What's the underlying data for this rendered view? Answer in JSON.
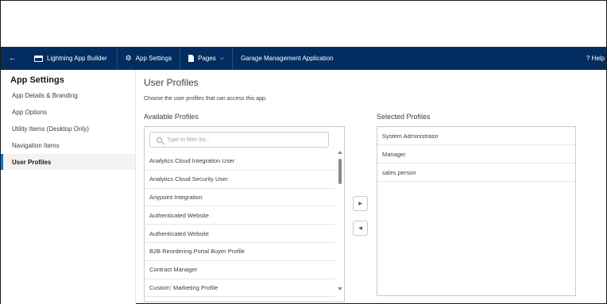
{
  "navbar": {
    "app_builder": "Lightning App Builder",
    "app_settings": "App Settings",
    "pages": "Pages",
    "app_name": "Garage Management Application",
    "help": "? Help"
  },
  "sidebar": {
    "title": "App Settings",
    "items": [
      {
        "label": "App Details & Branding"
      },
      {
        "label": "App Options"
      },
      {
        "label": "Utility Items (Desktop Only)"
      },
      {
        "label": "Navigation Items"
      },
      {
        "label": "User Profiles"
      }
    ],
    "active_index": 4
  },
  "main": {
    "title": "User Profiles",
    "description": "Choose the user profiles that can access this app.",
    "available_label": "Available Profiles",
    "selected_label": "Selected Profiles",
    "search_placeholder": "Type to filter list...",
    "available": [
      "Analytics Cloud Integration User",
      "Analytics Cloud Security User",
      "Anypoint Integration",
      "Authenticated Website",
      "Authenticated Website",
      "B2B Reordering Portal Buyer Profile",
      "Contract Manager",
      "Custom: Marketing Profile"
    ],
    "selected": [
      "System Administrator",
      "Manager",
      "sales person"
    ]
  },
  "colors": {
    "navbar_bg": "#032d60",
    "accent": "#0176d3"
  }
}
